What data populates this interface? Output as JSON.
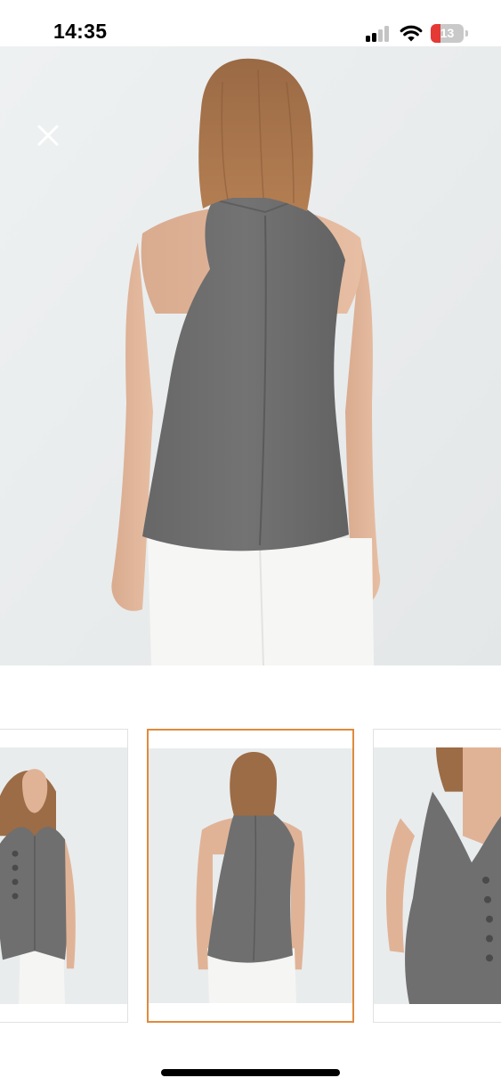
{
  "status_bar": {
    "time": "14:35",
    "signal_bars_active": 2,
    "signal_bars_total": 4,
    "battery_level": "13",
    "battery_fraction": 0.13,
    "icons": [
      "signal-icon",
      "wifi-icon",
      "battery-icon"
    ]
  },
  "viewer": {
    "close_icon": "close-icon",
    "main_image": "grey-halter-top-back-view",
    "thumbnails": [
      {
        "image": "grey-vest-front-view",
        "selected": false
      },
      {
        "image": "grey-halter-top-back-view",
        "selected": true
      },
      {
        "image": "grey-vest-side-view",
        "selected": false
      }
    ],
    "selected_index": 1
  },
  "colors": {
    "background": "#ffffff",
    "photo_backdrop": "#e9eced",
    "garment_grey": "#6f6f6f",
    "selected_border": "#e08a3c",
    "battery_low": "#e53935"
  }
}
